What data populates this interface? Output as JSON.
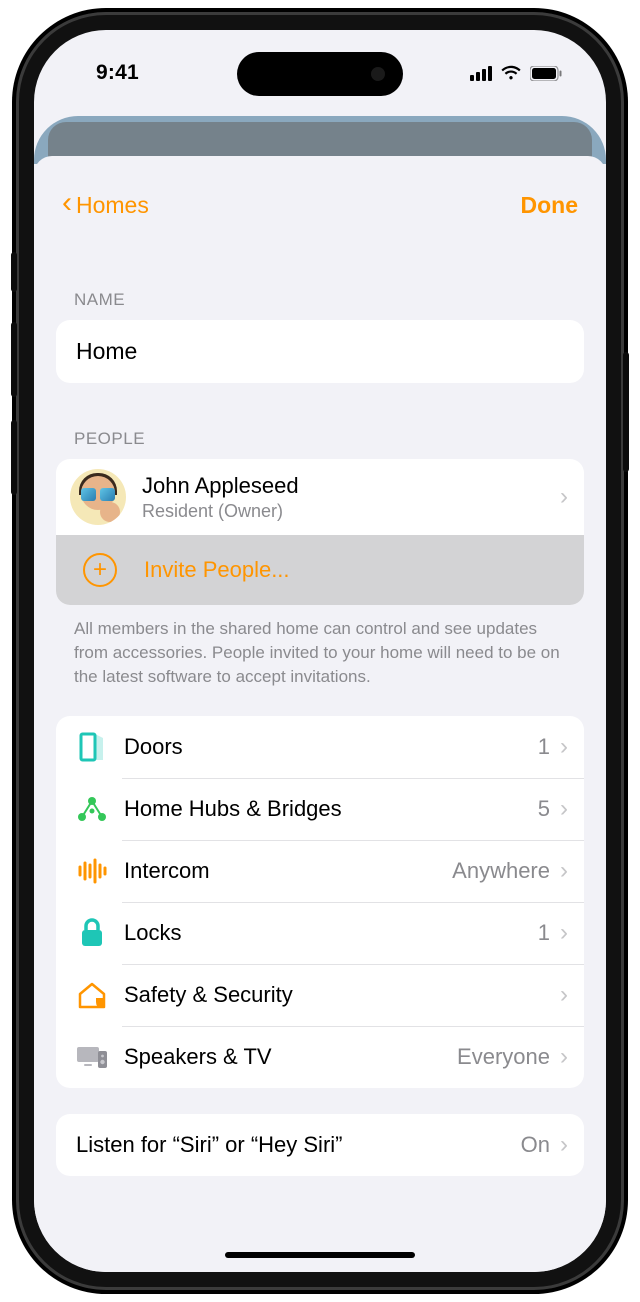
{
  "status": {
    "time": "9:41"
  },
  "nav": {
    "back": "Homes",
    "done": "Done"
  },
  "name_section": {
    "header": "NAME",
    "value": "Home"
  },
  "people_section": {
    "header": "PEOPLE",
    "person": {
      "name": "John Appleseed",
      "role": "Resident (Owner)"
    },
    "invite": "Invite People...",
    "footer": "All members in the shared home can control and see updates from accessories. People invited to your home will need to be on the latest software to accept invitations."
  },
  "categories": [
    {
      "label": "Doors",
      "value": "1"
    },
    {
      "label": "Home Hubs & Bridges",
      "value": "5"
    },
    {
      "label": "Intercom",
      "value": "Anywhere"
    },
    {
      "label": "Locks",
      "value": "1"
    },
    {
      "label": "Safety & Security",
      "value": ""
    },
    {
      "label": "Speakers & TV",
      "value": "Everyone"
    }
  ],
  "siri": {
    "label": "Listen for “Siri” or “Hey Siri”",
    "value": "On"
  }
}
